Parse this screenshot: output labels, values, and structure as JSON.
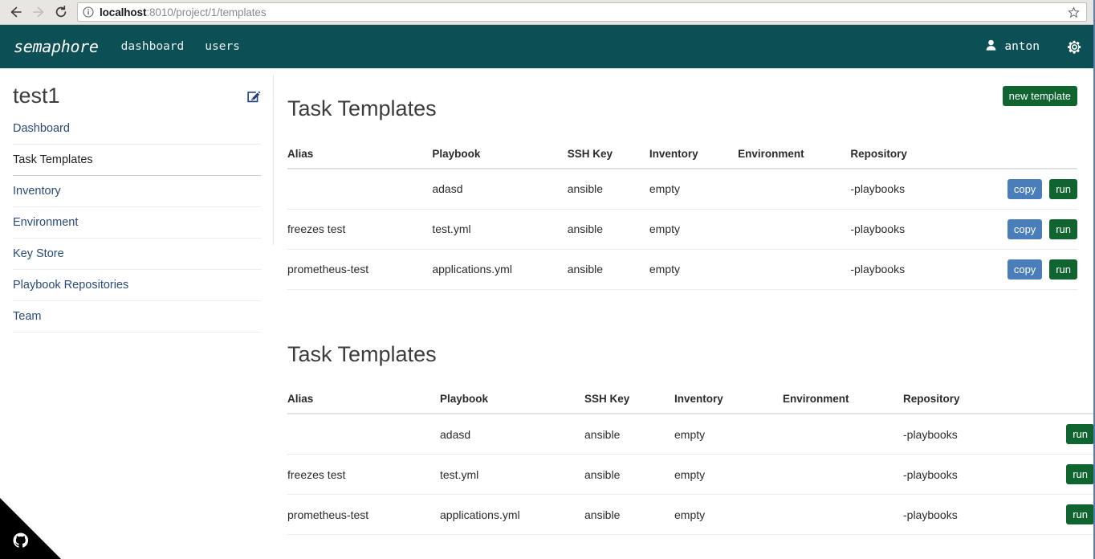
{
  "browser": {
    "back_icon": "back-arrow-icon",
    "forward_icon": "forward-arrow-icon",
    "reload_icon": "reload-icon",
    "info_icon": "site-info-icon",
    "bookmark_icon": "star-icon",
    "url_host": "localhost",
    "url_path": ":8010/project/1/templates",
    "url_full": "localhost:8010/project/1/templates"
  },
  "navbar": {
    "brand": "semaphore",
    "links": [
      {
        "label": "dashboard"
      },
      {
        "label": "users"
      }
    ],
    "user_icon": "user-icon",
    "user_name": "anton",
    "gear_icon": "gear-icon",
    "background_color": "#0c4f55"
  },
  "sidebar": {
    "project_name": "test1",
    "edit_icon": "edit-pencil-icon",
    "items": [
      {
        "label": "Dashboard",
        "active": false
      },
      {
        "label": "Task Templates",
        "active": true
      },
      {
        "label": "Inventory",
        "active": false
      },
      {
        "label": "Environment",
        "active": false
      },
      {
        "label": "Key Store",
        "active": false
      },
      {
        "label": "Playbook Repositories",
        "active": false
      },
      {
        "label": "Team",
        "active": false
      }
    ]
  },
  "main": {
    "sections": [
      {
        "title": "Task Templates",
        "new_template_label": "new template",
        "columns": [
          "Alias",
          "Playbook",
          "SSH Key",
          "Inventory",
          "Environment",
          "Repository",
          ""
        ],
        "rows": [
          {
            "alias": "",
            "playbook": "adasd",
            "ssh_key": "ansible",
            "inventory": "empty",
            "environment": "",
            "repository": "-playbooks",
            "copy_label": "copy",
            "run_label": "run"
          },
          {
            "alias": "freezes test",
            "playbook": "test.yml",
            "ssh_key": "ansible",
            "inventory": "empty",
            "environment": "",
            "repository": "-playbooks",
            "copy_label": "copy",
            "run_label": "run"
          },
          {
            "alias": "prometheus-test",
            "playbook": "applications.yml",
            "ssh_key": "ansible",
            "inventory": "empty",
            "environment": "",
            "repository": "-playbooks",
            "copy_label": "copy",
            "run_label": "run"
          }
        ]
      },
      {
        "title": "Task Templates",
        "columns": [
          "Alias",
          "Playbook",
          "SSH Key",
          "Inventory",
          "Environment",
          "Repository",
          ""
        ],
        "rows": [
          {
            "alias": "",
            "playbook": "adasd",
            "ssh_key": "ansible",
            "inventory": "empty",
            "environment": "",
            "repository": "-playbooks",
            "run_label": "run"
          },
          {
            "alias": "freezes test",
            "playbook": "test.yml",
            "ssh_key": "ansible",
            "inventory": "empty",
            "environment": "",
            "repository": "-playbooks",
            "run_label": "run"
          },
          {
            "alias": "prometheus-test",
            "playbook": "applications.yml",
            "ssh_key": "ansible",
            "inventory": "empty",
            "environment": "",
            "repository": "-playbooks",
            "run_label": "run"
          }
        ]
      }
    ]
  },
  "footer": {
    "github_ribbon_icon": "github-octocat-icon"
  },
  "colors": {
    "navbar": "#0c4f55",
    "button_green": "#10642f",
    "button_blue": "#4a7ebb",
    "link_blue": "#2a4a7c"
  }
}
